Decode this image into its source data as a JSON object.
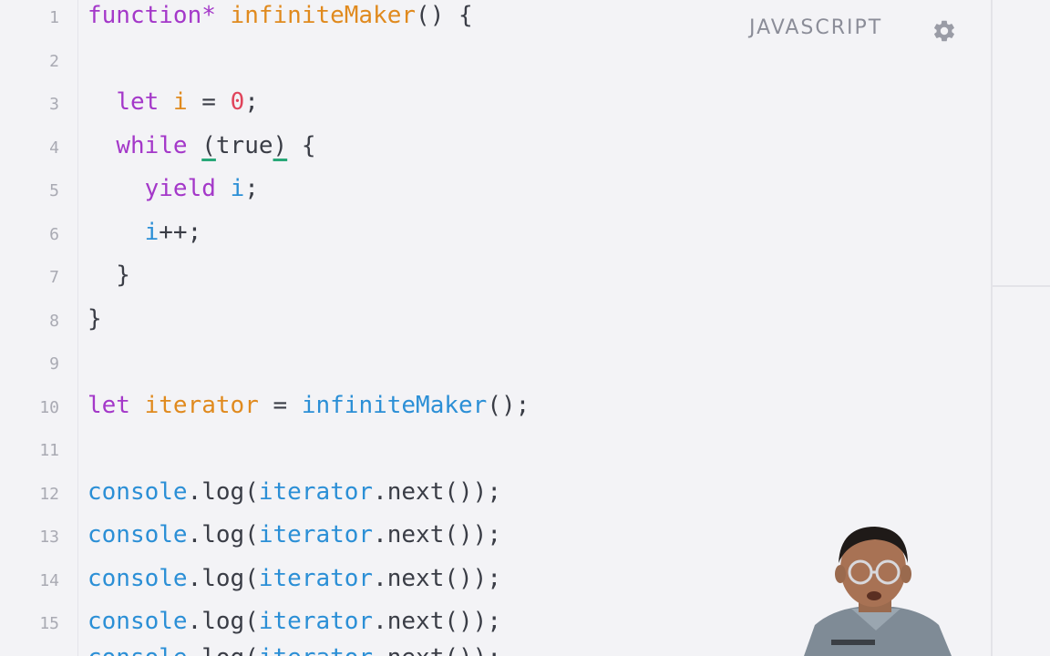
{
  "editor": {
    "language_label": "JAVASCRIPT",
    "settings_icon": "gear-icon",
    "lines": [
      {
        "num": "1",
        "tokens": [
          {
            "t": "function*",
            "c": "kw"
          },
          {
            "t": " ",
            "c": "plain"
          },
          {
            "t": "infiniteMaker",
            "c": "fn"
          },
          {
            "t": "() {",
            "c": "plain"
          }
        ]
      },
      {
        "num": "2",
        "tokens": []
      },
      {
        "num": "3",
        "tokens": [
          {
            "t": "  ",
            "c": "plain"
          },
          {
            "t": "let",
            "c": "kw"
          },
          {
            "t": " ",
            "c": "plain"
          },
          {
            "t": "i",
            "c": "fn"
          },
          {
            "t": " = ",
            "c": "plain"
          },
          {
            "t": "0",
            "c": "num"
          },
          {
            "t": ";",
            "c": "plain"
          }
        ]
      },
      {
        "num": "4",
        "tokens": [
          {
            "t": "  ",
            "c": "plain"
          },
          {
            "t": "while",
            "c": "kw"
          },
          {
            "t": " ",
            "c": "plain"
          },
          {
            "t": "(",
            "c": "green"
          },
          {
            "t": "true",
            "c": "plain"
          },
          {
            "t": ")",
            "c": "green"
          },
          {
            "t": " {",
            "c": "plain"
          }
        ]
      },
      {
        "num": "5",
        "tokens": [
          {
            "t": "    ",
            "c": "plain"
          },
          {
            "t": "yield",
            "c": "kw"
          },
          {
            "t": " ",
            "c": "plain"
          },
          {
            "t": "i",
            "c": "var"
          },
          {
            "t": ";",
            "c": "plain"
          }
        ]
      },
      {
        "num": "6",
        "tokens": [
          {
            "t": "    ",
            "c": "plain"
          },
          {
            "t": "i",
            "c": "var"
          },
          {
            "t": "++;",
            "c": "plain"
          }
        ]
      },
      {
        "num": "7",
        "tokens": [
          {
            "t": "  }",
            "c": "plain"
          }
        ]
      },
      {
        "num": "8",
        "tokens": [
          {
            "t": "}",
            "c": "plain"
          }
        ]
      },
      {
        "num": "9",
        "tokens": []
      },
      {
        "num": "10",
        "tokens": [
          {
            "t": "let",
            "c": "kw"
          },
          {
            "t": " ",
            "c": "plain"
          },
          {
            "t": "iterator",
            "c": "fn"
          },
          {
            "t": " = ",
            "c": "plain"
          },
          {
            "t": "infiniteMaker",
            "c": "var"
          },
          {
            "t": "();",
            "c": "plain"
          }
        ]
      },
      {
        "num": "11",
        "tokens": []
      },
      {
        "num": "12",
        "tokens": [
          {
            "t": "console",
            "c": "var"
          },
          {
            "t": ".log(",
            "c": "plain"
          },
          {
            "t": "iterator",
            "c": "var"
          },
          {
            "t": ".next());",
            "c": "plain"
          }
        ]
      },
      {
        "num": "13",
        "tokens": [
          {
            "t": "console",
            "c": "var"
          },
          {
            "t": ".log(",
            "c": "plain"
          },
          {
            "t": "iterator",
            "c": "var"
          },
          {
            "t": ".next());",
            "c": "plain"
          }
        ]
      },
      {
        "num": "14",
        "tokens": [
          {
            "t": "console",
            "c": "var"
          },
          {
            "t": ".log(",
            "c": "plain"
          },
          {
            "t": "iterator",
            "c": "var"
          },
          {
            "t": ".next());",
            "c": "plain"
          }
        ]
      },
      {
        "num": "15",
        "tokens": [
          {
            "t": "console",
            "c": "var"
          },
          {
            "t": ".log(",
            "c": "plain"
          },
          {
            "t": "iterator",
            "c": "var"
          },
          {
            "t": ".next());",
            "c": "plain"
          }
        ]
      },
      {
        "num": "",
        "tokens": [
          {
            "t": "console",
            "c": "var"
          },
          {
            "t": ".log(",
            "c": "plain"
          },
          {
            "t": "iterator",
            "c": "var"
          },
          {
            "t": ".next());",
            "c": "plain"
          }
        ]
      }
    ]
  },
  "colors": {
    "keyword": "#a438c9",
    "function": "#e08a1e",
    "number": "#e0445b",
    "variable": "#2b8fd6",
    "text": "#3a3d46",
    "background": "#f3f3f6"
  },
  "webcam_overlay": {
    "icon": "presenter-video"
  }
}
